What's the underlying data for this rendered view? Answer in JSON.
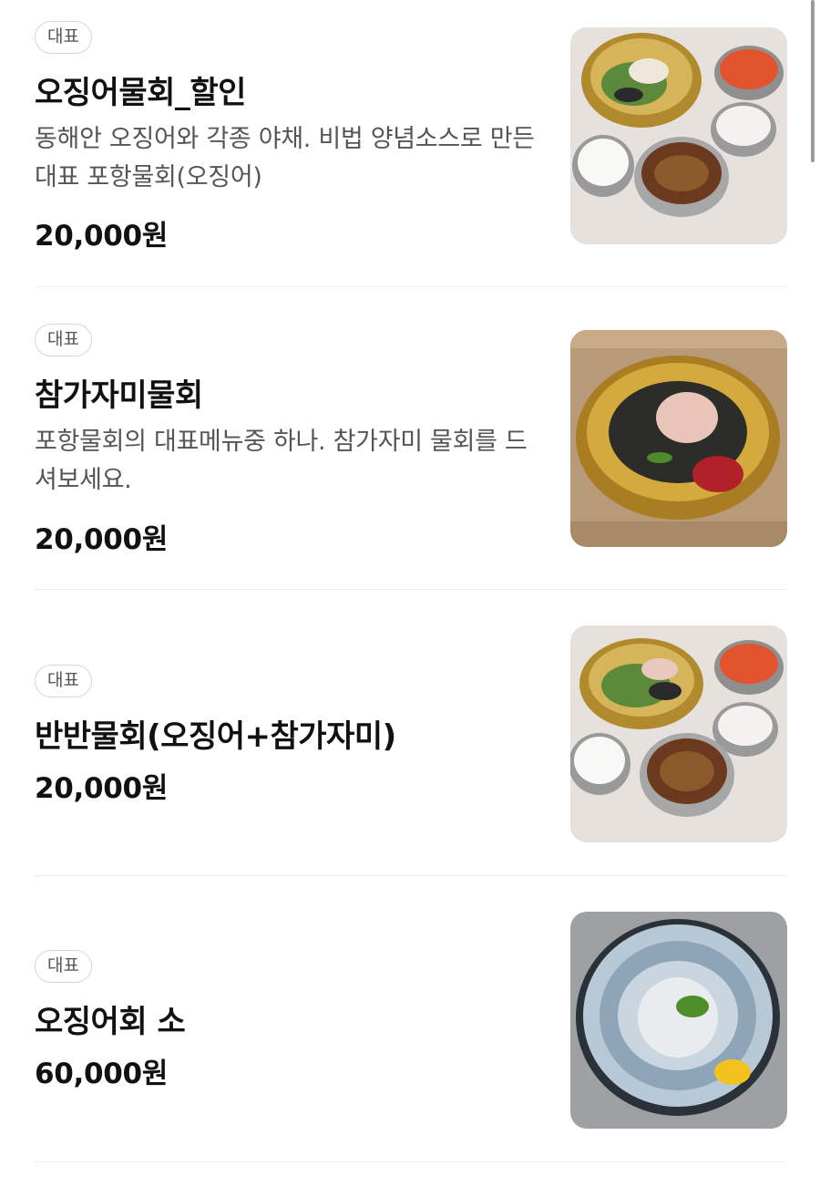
{
  "menu": {
    "items": [
      {
        "badge": "대표",
        "name": "오징어물회_할인",
        "description": "동해안 오징어와 각종 야채. 비법 양념소스로 만든 대표 포항물회(오징어)",
        "price": "20,000원",
        "image": "squid-mulhoe-set-photo"
      },
      {
        "badge": "대표",
        "name": "참가자미물회",
        "description": "포항물회의 대표메뉴중 하나. 참가자미 물회를 드셔보세요.",
        "price": "20,000원",
        "image": "flounder-mulhoe-photo"
      },
      {
        "badge": "대표",
        "name": "반반물회(오징어+참가자미)",
        "description": "",
        "price": "20,000원",
        "image": "half-half-mulhoe-set-photo"
      },
      {
        "badge": "대표",
        "name": "오징어회 소",
        "description": "",
        "price": "60,000원",
        "image": "squid-sashimi-platter-photo"
      }
    ]
  },
  "colors": {
    "background": "#ffffff",
    "text_primary": "#111111",
    "text_secondary": "#555555",
    "badge_border": "#d6d6d6",
    "divider": "#eeeeee"
  }
}
